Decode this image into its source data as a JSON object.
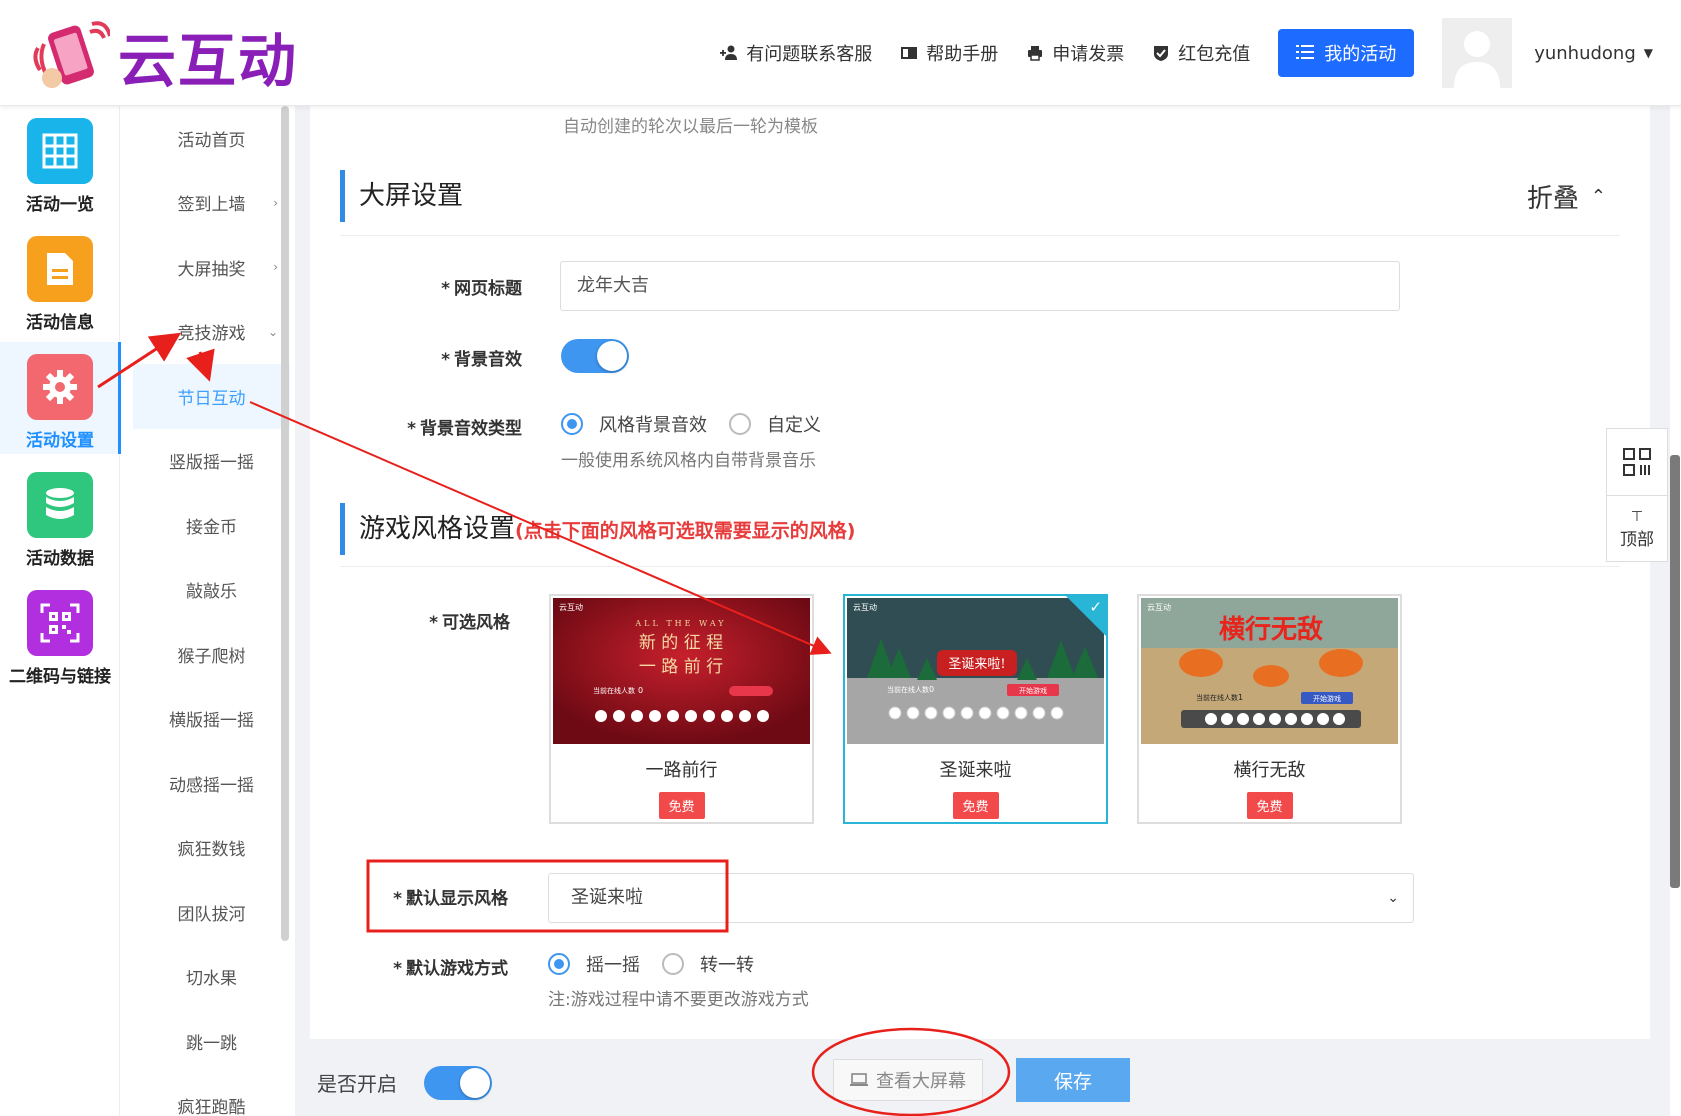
{
  "header": {
    "logo_text": "云互动",
    "links": [
      {
        "label": "有问题联系客服",
        "icon": "user-plus-icon"
      },
      {
        "label": "帮助手册",
        "icon": "book-icon"
      },
      {
        "label": "申请发票",
        "icon": "printer-icon"
      },
      {
        "label": "红包充值",
        "icon": "shield-check-icon"
      }
    ],
    "my_activity_label": "我的活动",
    "username": "yunhudong"
  },
  "icon_sidebar": {
    "items": [
      {
        "label": "活动一览",
        "icon": "grid-icon",
        "color": "#18b4ea"
      },
      {
        "label": "活动信息",
        "icon": "document-icon",
        "color": "#f7a01e"
      },
      {
        "label": "活动设置",
        "icon": "gear-icon",
        "color": "#f2686e",
        "active": true
      },
      {
        "label": "活动数据",
        "icon": "database-icon",
        "color": "#2ec77d"
      },
      {
        "label": "二维码与链接",
        "icon": "qrcode-icon",
        "color": "#b22fe0"
      }
    ]
  },
  "menu": {
    "items": [
      "活动首页",
      "签到上墙",
      "大屏抽奖",
      "竞技游戏",
      "节日互动",
      "竖版摇一摇",
      "接金币",
      "敲敲乐",
      "猴子爬树",
      "横版摇一摇",
      "动感摇一摇",
      "疯狂数钱",
      "团队拔河",
      "切水果",
      "跳一跳",
      "疯狂跑酷"
    ],
    "active_index": 4
  },
  "form": {
    "top_hint": "自动创建的轮次以最后一轮为模板",
    "screen_section_title": "大屏设置",
    "collapse_label": "折叠",
    "page_title_label": "网页标题",
    "page_title_value": "龙年大吉",
    "bg_music_label": "背景音效",
    "bg_music_on": true,
    "bg_music_type_label": "背景音效类型",
    "bg_music_type_options": [
      "风格背景音效",
      "自定义"
    ],
    "bg_music_type_selected": 0,
    "bg_music_hint": "一般使用系统风格内自带背景音乐",
    "style_section_title": "游戏风格设置",
    "style_section_subtitle": "(点击下面的风格可选取需要显示的风格)",
    "available_styles_label": "可选风格",
    "styles": [
      {
        "name": "一路前行",
        "badge": "免费",
        "thumb_text_1": "新 的 征 程",
        "thumb_text_2": "一 路 前 行",
        "thumb_caption": "ALL THE WAY",
        "thumb_logo": "云互动",
        "thumb_online": "当前在线人数",
        "thumb_count": "0"
      },
      {
        "name": "圣诞来啦",
        "badge": "免费",
        "selected": true,
        "thumb_text_1": "圣诞来啦!",
        "thumb_logo": "云互动",
        "thumb_online": "当前在线人数",
        "thumb_count": "0",
        "thumb_btn": "开始游戏"
      },
      {
        "name": "横行无敌",
        "badge": "免费",
        "thumb_text_1": "横行无敌",
        "thumb_logo": "云互动",
        "thumb_online": "当前在线人数",
        "thumb_count": "1",
        "thumb_btn": "开始游戏"
      }
    ],
    "default_style_label": "默认显示风格",
    "default_style_value": "圣诞来啦",
    "game_mode_label": "默认游戏方式",
    "game_mode_options": [
      "摇一摇",
      "转一转"
    ],
    "game_mode_selected": 0,
    "game_mode_hint": "注:游戏过程中请不要更改游戏方式"
  },
  "bottom": {
    "enable_label": "是否开启",
    "enabled": true,
    "view_screen_label": "查看大屏幕",
    "save_label": "保存"
  },
  "float": {
    "top_label": "顶部"
  }
}
